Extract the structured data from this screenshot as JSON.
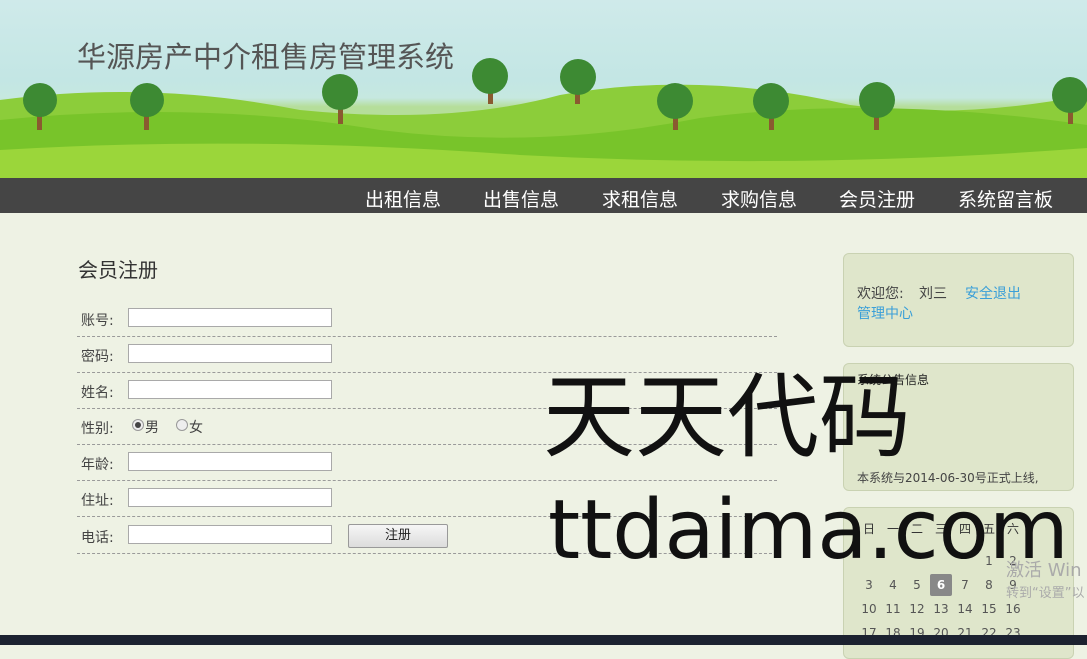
{
  "site": {
    "title": "华源房产中介租售房管理系统"
  },
  "nav": {
    "items": [
      "出租信息",
      "出售信息",
      "求租信息",
      "求购信息",
      "会员注册",
      "系统留言板"
    ]
  },
  "form": {
    "heading": "会员注册",
    "account_label": "账号:",
    "password_label": "密码:",
    "name_label": "姓名:",
    "gender_label": "性别:",
    "gender_male": "男",
    "gender_female": "女",
    "gender_selected": "男",
    "age_label": "年龄:",
    "address_label": "住址:",
    "phone_label": "电话:",
    "submit_label": "注册"
  },
  "user_panel": {
    "welcome": "欢迎您:",
    "username": "刘三",
    "logout": "安全退出",
    "admin_center": "管理中心"
  },
  "notice": {
    "title": "系统公告信息",
    "text": "本系统与2014-06-30号正式上线,"
  },
  "calendar": {
    "weekdays": [
      "日",
      "一",
      "二",
      "三",
      "四",
      "五",
      "六"
    ],
    "today": "6",
    "rows": [
      [
        "",
        "",
        "",
        "",
        "",
        "1",
        "2"
      ],
      [
        "3",
        "4",
        "5",
        "6",
        "7",
        "8",
        "9"
      ],
      [
        "10",
        "11",
        "12",
        "13",
        "14",
        "15",
        "16"
      ],
      [
        "17",
        "18",
        "19",
        "20",
        "21",
        "22",
        "23"
      ]
    ]
  },
  "watermark": {
    "line1": "天天代码",
    "line2": "ttdaima.com"
  },
  "os_overlay": {
    "line1": "激活 Win",
    "line2": "转到“设置”以"
  },
  "colors": {
    "nav_bg": "#454545",
    "link": "#3a9fd8",
    "grass": "#8dcf2e"
  }
}
